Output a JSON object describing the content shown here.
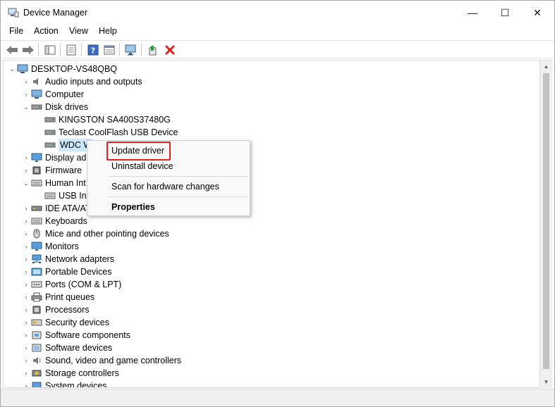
{
  "window": {
    "title": "Device Manager",
    "controls": {
      "minimize": "—",
      "maximize": "☐",
      "close": "✕"
    }
  },
  "menu": [
    "File",
    "Action",
    "View",
    "Help"
  ],
  "toolbar": {
    "buttons": [
      "back-icon",
      "forward-icon",
      "show-hide-tree-icon",
      "properties-icon",
      "help-icon",
      "details-icon",
      "scan-monitor-icon",
      "update-driver-icon",
      "uninstall-x-icon"
    ]
  },
  "tree": {
    "root": "DESKTOP-VS48QBQ",
    "items": [
      {
        "label": "Audio inputs and outputs",
        "icon": "speaker-icon"
      },
      {
        "label": "Computer",
        "icon": "computer-icon"
      },
      {
        "label": "Disk drives",
        "icon": "disk-drive-icon"
      },
      {
        "label": "KINGSTON SA400S37480G",
        "icon": "disk-drive-icon"
      },
      {
        "label": "Teclast CoolFlash USB Device",
        "icon": "disk-drive-icon"
      },
      {
        "label": "WDC W",
        "icon": "disk-drive-icon"
      },
      {
        "label": "Display ad",
        "icon": "monitor-icon"
      },
      {
        "label": "Firmware",
        "icon": "chip-icon"
      },
      {
        "label": "Human Int",
        "icon": "keyboard-icon"
      },
      {
        "label": "USB Inp",
        "icon": "keyboard-icon"
      },
      {
        "label": "IDE ATA/AT",
        "icon": "controller-icon"
      },
      {
        "label": "Keyboards",
        "icon": "keyboard-icon"
      },
      {
        "label": "Mice and other pointing devices",
        "icon": "mouse-icon"
      },
      {
        "label": "Monitors",
        "icon": "monitor-icon"
      },
      {
        "label": "Network adapters",
        "icon": "network-icon"
      },
      {
        "label": "Portable Devices",
        "icon": "portable-icon"
      },
      {
        "label": "Ports (COM & LPT)",
        "icon": "port-icon"
      },
      {
        "label": "Print queues",
        "icon": "printer-icon"
      },
      {
        "label": "Processors",
        "icon": "cpu-icon"
      },
      {
        "label": "Security devices",
        "icon": "security-icon"
      },
      {
        "label": "Software components",
        "icon": "puzzle-icon"
      },
      {
        "label": "Software devices",
        "icon": "software-icon"
      },
      {
        "label": "Sound, video and game controllers",
        "icon": "sound-icon"
      },
      {
        "label": "Storage controllers",
        "icon": "storage-icon"
      },
      {
        "label": "System devices",
        "icon": "system-icon"
      }
    ]
  },
  "context_menu": {
    "update_driver": "Update driver",
    "uninstall_device": "Uninstall device",
    "scan_hardware": "Scan for hardware changes",
    "properties": "Properties"
  },
  "colors": {
    "highlight_box": "#e0201a",
    "selection": "#cce8ff"
  }
}
